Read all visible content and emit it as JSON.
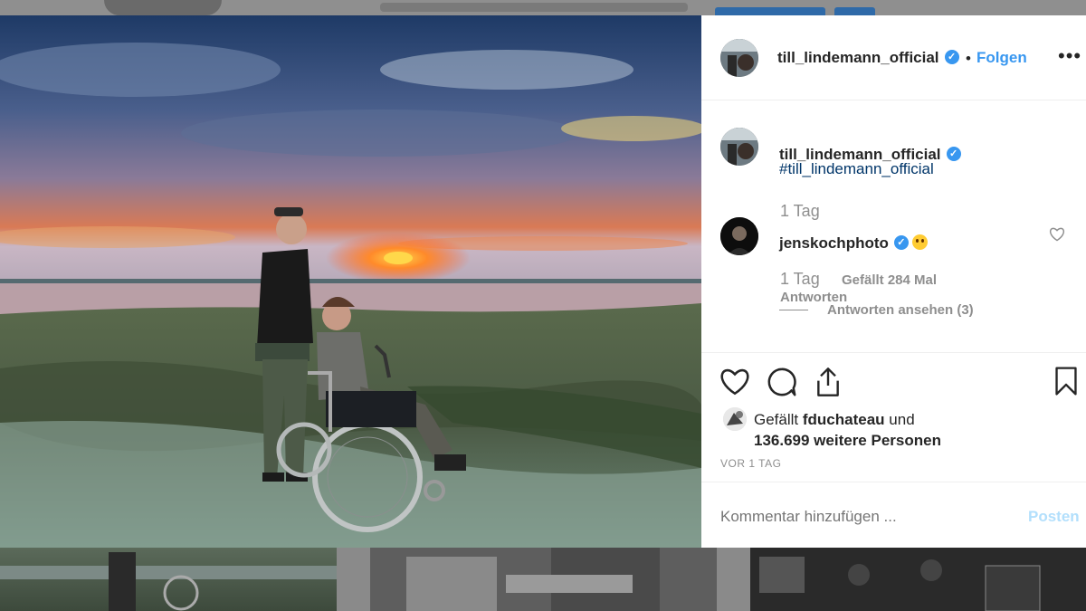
{
  "post": {
    "author": "till_lindemann_official",
    "follow_label": "Folgen",
    "separator": "•",
    "more_label": "•••",
    "caption_user": "till_lindemann_official",
    "caption_text": "#till_lindemann_official",
    "caption_time": "1 Tag"
  },
  "comment": {
    "user": "jenskochphoto",
    "time": "1 Tag",
    "likes": "Gefällt 284 Mal",
    "reply_label": "Antworten",
    "view_replies": "Antworten ansehen (3)"
  },
  "likes": {
    "prefix": "Gefällt",
    "user": "fduchateau",
    "connector": "und",
    "others": "136.699 weitere Personen"
  },
  "timestamp": "VOR 1 TAG",
  "composer": {
    "placeholder": "Kommentar hinzufügen ...",
    "post_label": "Posten"
  },
  "colors": {
    "accent": "#3897f0",
    "text": "#262626",
    "secondary": "#8e8e8e"
  },
  "icons": [
    "heart-icon",
    "comment-icon",
    "share-icon",
    "bookmark-icon",
    "verified-badge-icon",
    "more-options-icon"
  ]
}
